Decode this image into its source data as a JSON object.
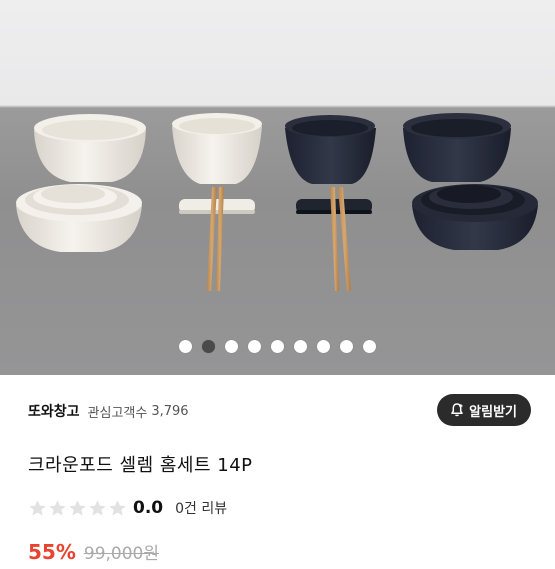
{
  "hero": {
    "image_description": "product photo",
    "carousel": {
      "total": 9,
      "active_index": 1
    },
    "colors": {
      "cream": "#f1ede6",
      "navy": "#242836",
      "wood": "#c9975f"
    }
  },
  "shop": {
    "name": "또와창고",
    "follow_label": "관심고객수",
    "follow_count": "3,796",
    "notify_label": "알림받기"
  },
  "product": {
    "title": "크라운포드 셀렘 홈세트 14P",
    "rating": "0.0",
    "review_count_label": "0건 리뷰",
    "stars_filled": 0,
    "stars_total": 5,
    "discount": "55%",
    "original_price": "99,000원"
  },
  "theme": {
    "accent": "#e8432f",
    "button_bg": "#2b2b2b"
  }
}
